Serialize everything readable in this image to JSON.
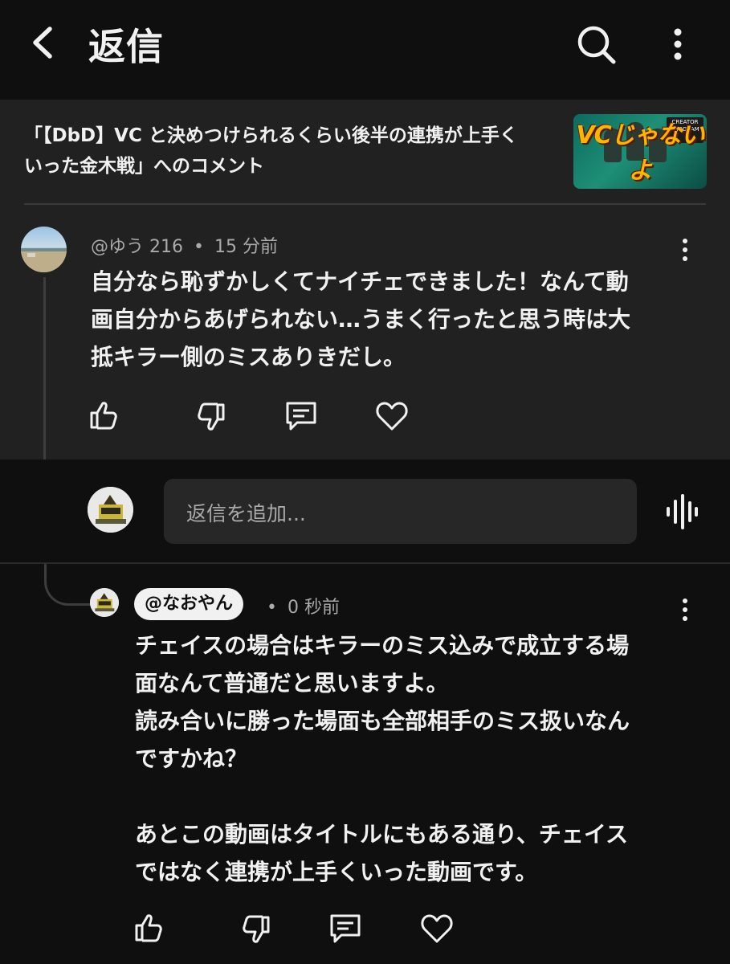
{
  "header": {
    "title": "返信",
    "icons": [
      "back-arrow-icon",
      "search-icon",
      "more-vert-icon"
    ]
  },
  "video": {
    "title_line1": "「【DbD】VC と決めつけられるくらい後半の連携が上手く",
    "title_line2": "いった金木戦」へのコメント",
    "thumbnail_text": "VCじゃないよ",
    "thumbnail_badge_line1": "CREATOR",
    "thumbnail_badge_line2": "PROGRAM"
  },
  "comment": {
    "author": "@ゆう 216",
    "separator": "•",
    "time": "15 分前",
    "lines": [
      "自分なら恥ずかしくてナイチェできました！なんて動",
      "画自分からあげられない…うまく行ったと思う時は大",
      "抵キラー側のミスありきだし。"
    ]
  },
  "reply_box": {
    "placeholder": "返信を追加..."
  },
  "reply": {
    "author": "@なおやん",
    "separator": "•",
    "time": "0 秒前",
    "lines": [
      "チェイスの場合はキラーのミス込みで成立する場",
      "面なんて普通だと思いますよ。",
      "読み合いに勝った場面も全部相手のミス扱いなん",
      "ですかね？",
      "",
      "あとこの動画はタイトルにもある通り、チェイス",
      "ではなく連携が上手くいった動画です。"
    ]
  },
  "colors": {
    "background": "#0f0f0f",
    "panel": "#212121",
    "input": "#272727",
    "text": "#f1f1f1",
    "secondary": "#aaaaaa"
  }
}
